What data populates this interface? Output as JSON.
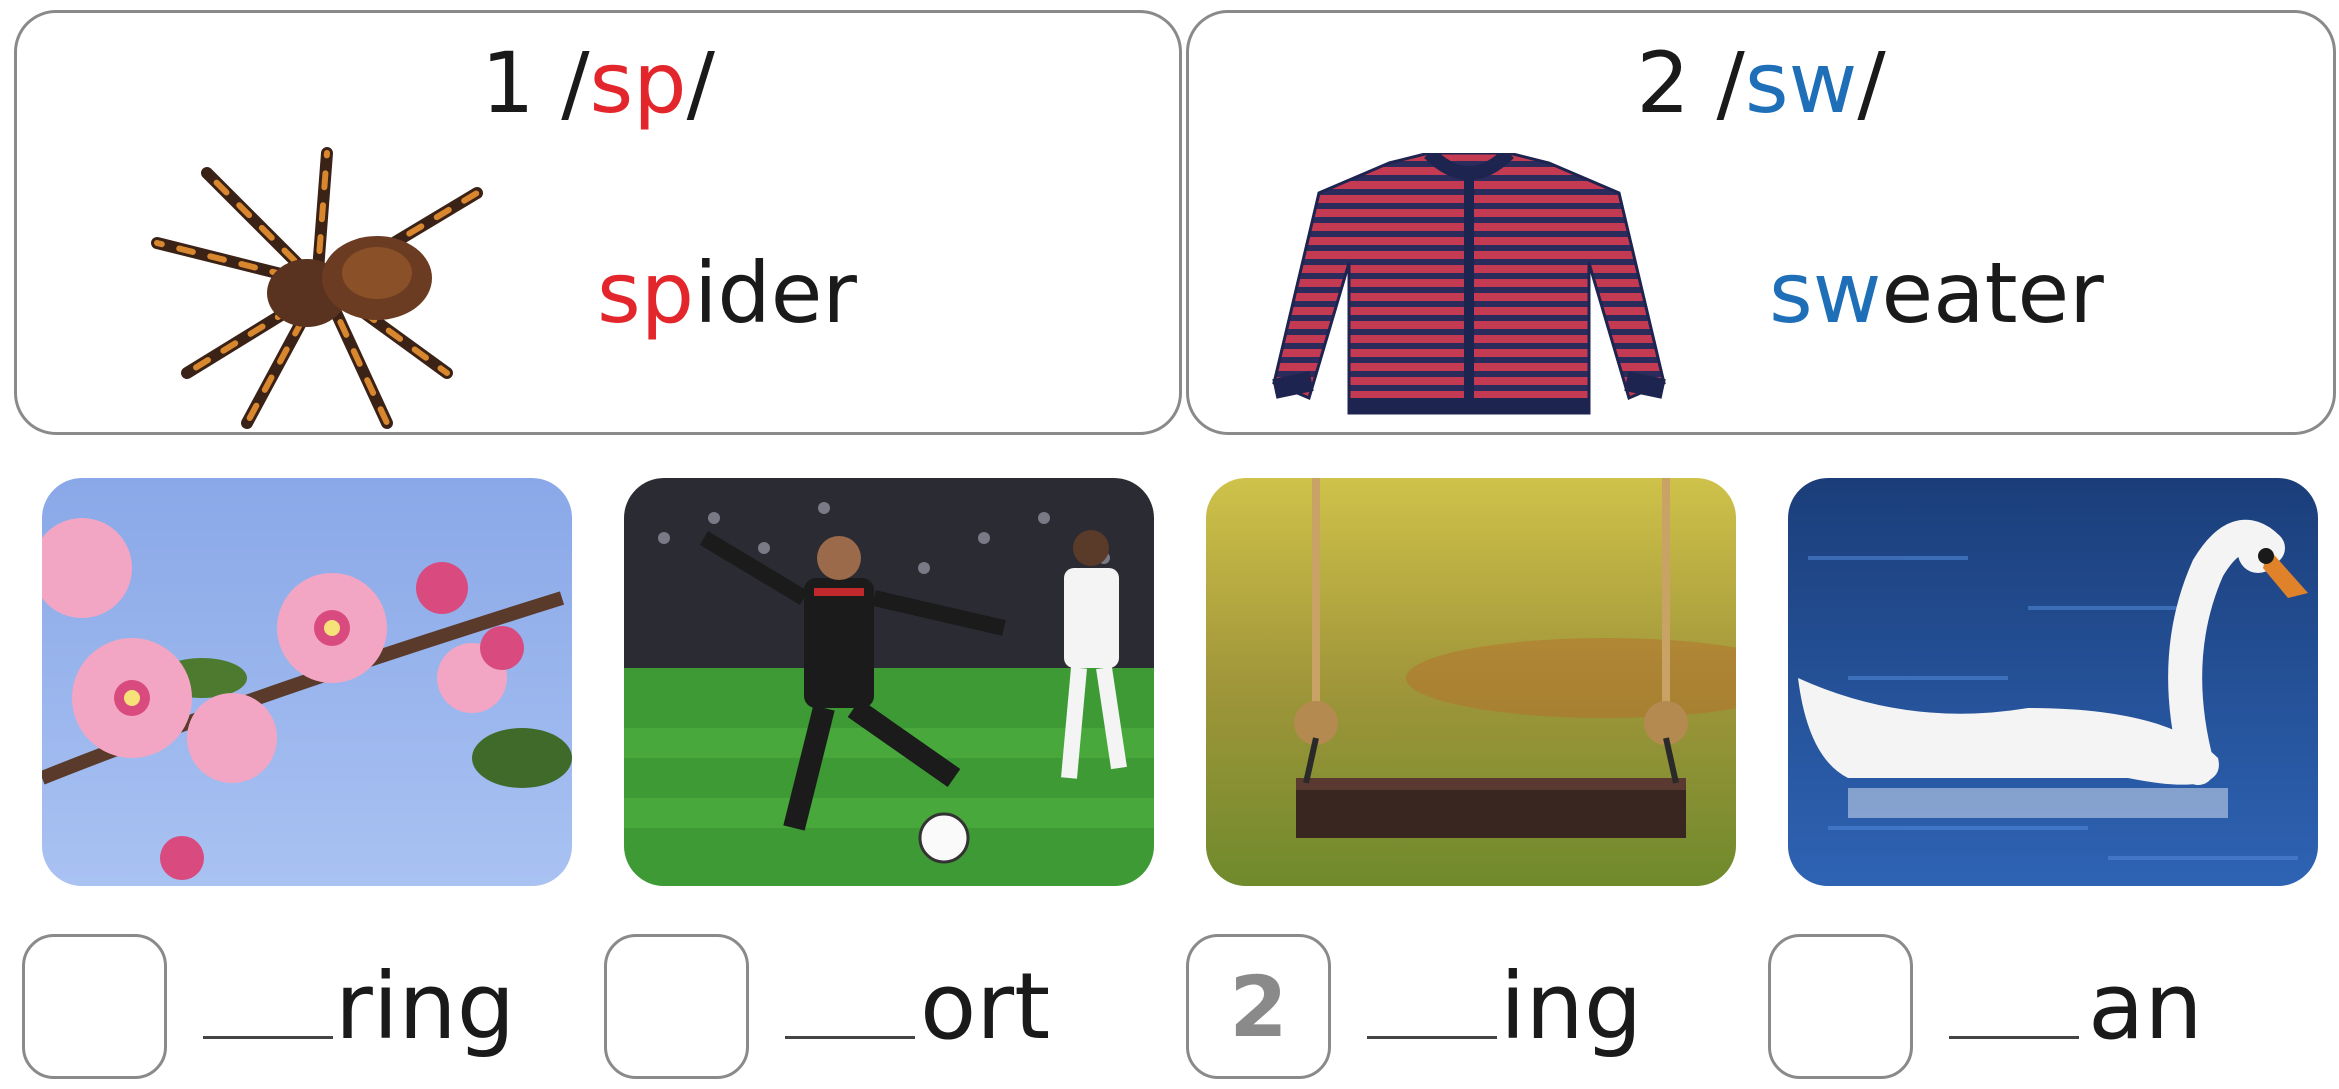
{
  "cards": [
    {
      "number": "1",
      "slash_open": "/",
      "sound": "sp",
      "slash_close": "/",
      "word_prefix": "sp",
      "word_rest": "ider",
      "picture": "spider-picture",
      "sound_color": "#e3262b"
    },
    {
      "number": "2",
      "slash_open": "/",
      "sound": "sw",
      "slash_close": "/",
      "word_prefix": "sw",
      "word_rest": "eater",
      "picture": "sweater-picture",
      "sound_color": "#1f6fb8"
    }
  ],
  "exercises": [
    {
      "picture": "blossom-picture",
      "answer": "",
      "suffix": "ring"
    },
    {
      "picture": "football-player-picture",
      "answer": "",
      "suffix": "ort"
    },
    {
      "picture": "swing-picture",
      "answer": "2",
      "suffix": "ing"
    },
    {
      "picture": "swan-picture",
      "answer": "",
      "suffix": "an"
    }
  ]
}
